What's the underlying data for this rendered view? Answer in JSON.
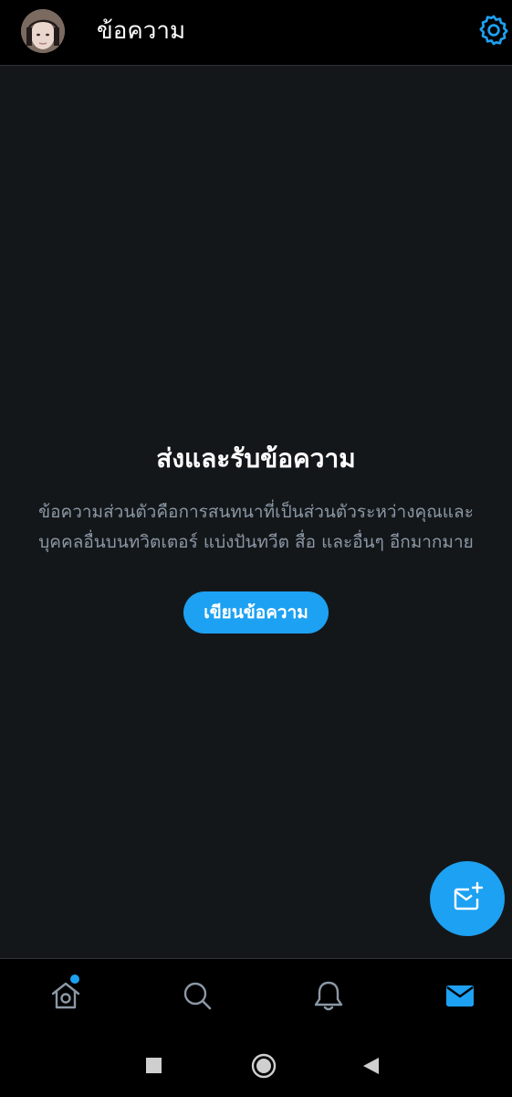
{
  "header": {
    "title": "ข้อความ",
    "avatar_icon": "user-avatar",
    "settings_icon": "gear-icon"
  },
  "empty_state": {
    "title": "ส่งและรับข้อความ",
    "description": "ข้อความส่วนตัวคือการสนทนาที่เป็นส่วนตัวระหว่างคุณและบุคคลอื่นบนทวิตเตอร์ แบ่งปันทวีต สื่อ และอื่นๆ อีกมากมาย",
    "button_label": "เขียนข้อความ"
  },
  "fab": {
    "icon": "new-message-icon"
  },
  "bottom_nav": {
    "items": [
      {
        "id": "home",
        "icon": "home-icon",
        "has_notification_dot": true,
        "active": false
      },
      {
        "id": "search",
        "icon": "search-icon",
        "active": false
      },
      {
        "id": "notifications",
        "icon": "bell-icon",
        "active": false
      },
      {
        "id": "messages",
        "icon": "envelope-icon",
        "active": true
      }
    ]
  },
  "system_nav": {
    "items": [
      "recents-square-icon",
      "home-circle-icon",
      "back-triangle-icon"
    ]
  },
  "colors": {
    "accent": "#1da1f2",
    "background": "#14171a",
    "bar_background": "#000000",
    "secondary_text": "#8b98a5",
    "inactive_icon": "#8b98a5"
  }
}
